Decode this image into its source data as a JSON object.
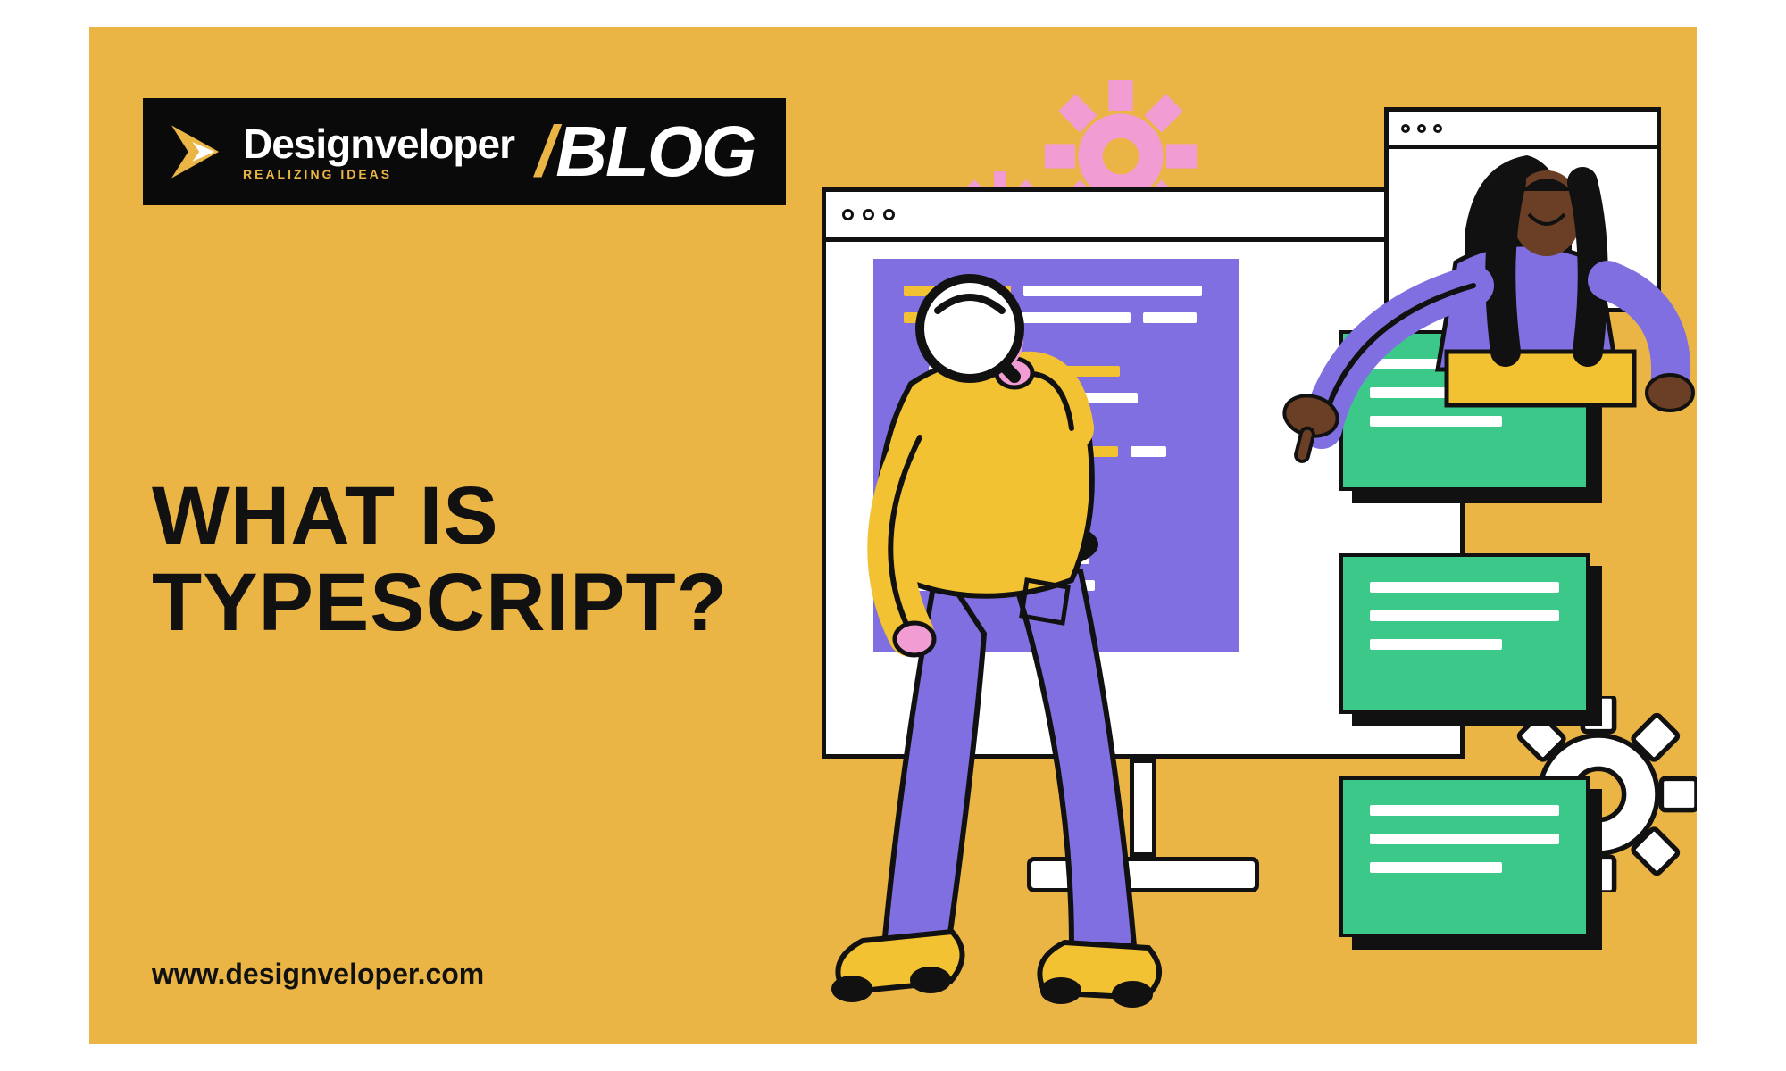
{
  "logo": {
    "brand": "Designveloper",
    "tagline": "REALIZING IDEAS",
    "section": "BLOG"
  },
  "headline": {
    "line1": "WHAT IS",
    "line2": "TYPESCRIPT?"
  },
  "site_url": "www.designveloper.com",
  "colors": {
    "bg": "#eab545",
    "purple": "#806fe0",
    "green": "#3cc889",
    "pink": "#f19cd3",
    "yellow": "#f2c233",
    "ink": "#111111"
  },
  "icons": {
    "gear_large": "gear-icon",
    "gear_small": "gear-icon",
    "gear_white": "gear-icon",
    "magnifier": "magnifier-icon"
  }
}
